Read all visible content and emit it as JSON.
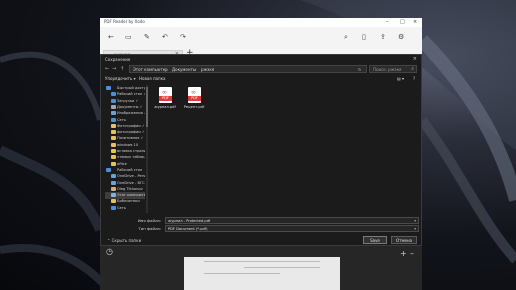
{
  "app": {
    "title": "PDF Reader by Xodo",
    "tab_label": "журнал",
    "tab_close": "×",
    "tab_add": "+",
    "window_controls": [
      "–",
      "□",
      "×"
    ],
    "toolbar_icons": [
      "back-arrow-icon",
      "save-icon",
      "pen-icon",
      "undo-icon",
      "redo-icon",
      "search-icon",
      "doc-icon",
      "share-icon",
      "settings-icon"
    ]
  },
  "dialog": {
    "title": "Сохранение",
    "close": "×",
    "nav": {
      "back": "←",
      "forward": "→",
      "up": "↑",
      "refresh": "↻"
    },
    "breadcrumb": [
      "Этот компьютер",
      "Документы",
      "ржэкя"
    ],
    "breadcrumb_sep": "›",
    "search_placeholder": "Поиск: ржэкя",
    "search_icon": "⌕",
    "commands": {
      "organize": "Упорядочить ▾",
      "new_folder": "Новая папка",
      "view": "▤ ▾",
      "help": "?"
    },
    "nav_pane": [
      {
        "label": "Быстрый доступ",
        "icon": "star-icon",
        "color": "#4a90d9",
        "indent": 0
      },
      {
        "label": "Рабочий стол  ✓",
        "icon": "desktop-icon",
        "color": "#4a90d9",
        "indent": 1
      },
      {
        "label": "Загрузки  ✓",
        "icon": "download-icon",
        "color": "#4a90d9",
        "indent": 1
      },
      {
        "label": "Документы  ✓",
        "icon": "documents-icon",
        "color": "#9aa7b5",
        "indent": 1
      },
      {
        "label": "Изображения  ✓",
        "icon": "pictures-icon",
        "color": "#6aa1d8",
        "indent": 1
      },
      {
        "label": "Сеть",
        "icon": "network-icon",
        "color": "#4a90d9",
        "indent": 1
      },
      {
        "label": "Фотографии  ✓",
        "icon": "folder-icon",
        "color": "#e8c15a",
        "indent": 1
      },
      {
        "label": "фотографии  ✓",
        "icon": "folder-icon",
        "color": "#e8c15a",
        "indent": 1
      },
      {
        "label": "Позитивное  ✓",
        "icon": "folder-icon",
        "color": "#e8c15a",
        "indent": 1
      },
      {
        "label": "windows 10",
        "icon": "folder-icon",
        "color": "#e8c15a",
        "indent": 1
      },
      {
        "label": "вставка страниц",
        "icon": "folder-icon",
        "color": "#e8c15a",
        "indent": 1
      },
      {
        "label": "чтемых таблиц",
        "icon": "folder-icon",
        "color": "#e8c15a",
        "indent": 1
      },
      {
        "label": "office",
        "icon": "folder-icon",
        "color": "#e8c15a",
        "indent": 1
      },
      {
        "label": "Рабочий стол",
        "icon": "desktop-icon",
        "color": "#4a90d9",
        "indent": 0
      },
      {
        "label": "OneDrive - Pers",
        "icon": "cloud-icon",
        "color": "#6aa1d8",
        "indent": 1
      },
      {
        "label": "OneDrive - ВГС",
        "icon": "cloud-icon",
        "color": "#6aa1d8",
        "indent": 1
      },
      {
        "label": "Oleg Tikhonov",
        "icon": "user-icon",
        "color": "#d0b070",
        "indent": 1
      },
      {
        "label": "Этот компьютер",
        "icon": "computer-icon",
        "color": "#7fb2e5",
        "indent": 1,
        "selected": true
      },
      {
        "label": "Библиотеки",
        "icon": "library-icon",
        "color": "#e8c15a",
        "indent": 1
      },
      {
        "label": "Сеть",
        "icon": "network-icon",
        "color": "#4a90d9",
        "indent": 1
      }
    ],
    "files": [
      {
        "name": "журнал.pdf",
        "badge": "PDF"
      },
      {
        "name": "Рецепт.pdf",
        "badge": "PDF"
      }
    ],
    "filename_label": "Имя файла:",
    "filename_value": "журнал - Protected.pdf",
    "filetype_label": "Тип файла:",
    "filetype_value": "PDF Document (*.pdf)",
    "chevron": "▾",
    "hide_folders": "⌃  Скрыть папки",
    "save_button": "Save",
    "cancel_button": "Отмена"
  },
  "colors": {
    "accent_pdf": "#e23b3b",
    "dialog_bg": "#1b1b1b",
    "titlebar_bg": "#ffffff"
  }
}
